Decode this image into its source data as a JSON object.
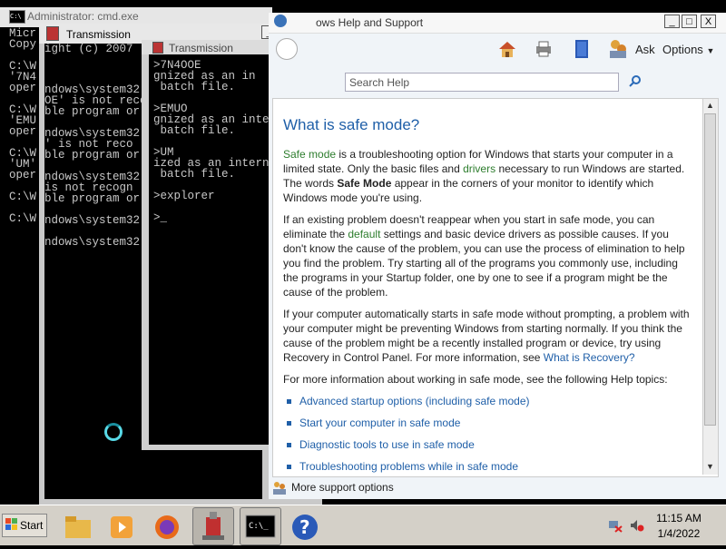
{
  "cmd_back": {
    "title": "Administrator: cmd.exe",
    "lines": [
      "Micr",
      "Copy",
      "",
      "C:\\W",
      "'7N4",
      "oper",
      "",
      "C:\\W",
      "'EMU",
      "oper",
      "",
      "C:\\W",
      "'UM'",
      "oper",
      "",
      "C:\\W",
      "",
      "C:\\W"
    ]
  },
  "cmd_window2": {
    "title": "Transmission",
    "header_fragment": "ight (c) 2007",
    "lines": [
      "",
      "",
      "",
      "ndows\\system32",
      "OE' is not reco",
      "ble program or",
      "",
      "ndows\\system32",
      "' is not reco",
      "ble program or",
      "",
      "ndows\\system32",
      "is not recogn",
      "ble program or",
      "",
      "ndows\\system32",
      "",
      "ndows\\system32"
    ]
  },
  "cmd_window3": {
    "title": "Transmission",
    "lines": [
      "",
      ">7N4OOE",
      "gnized as an in",
      " batch file.",
      "",
      ">EMUO",
      "gnized as an inte",
      " batch file.",
      "",
      ">UM",
      "ized as an intern",
      " batch file.",
      "",
      ">explorer",
      "",
      ">_"
    ]
  },
  "help": {
    "title": "ows Help and Support",
    "toolbar": {
      "ask_label": "Ask",
      "options_label": "Options"
    },
    "search_placeholder": "Search Help",
    "heading": "What is safe mode?",
    "p1": {
      "link1": "Safe mode",
      "t1": " is a troubleshooting option for Windows that starts your computer in a limited state. Only the basic files and ",
      "link2": "drivers",
      "t2": " necessary to run Windows are started. The words ",
      "bold": "Safe Mode",
      "t3": " appear in the corners of your monitor to identify which Windows mode you're using."
    },
    "p2": {
      "t1": "If an existing problem doesn't reappear when you start in safe mode, you can eliminate the ",
      "link": "default",
      "t2": " settings and basic device drivers as possible causes. If you don't know the cause of the problem, you can use the process of elimination to help you find the problem. Try starting all of the programs you commonly use, including the programs in your Startup folder, one by one to see if a program might be the cause of the problem."
    },
    "p3": {
      "t1": "If your computer automatically starts in safe mode without prompting, a problem with your computer might be preventing Windows from starting normally. If you think the cause of the problem might be a recently installed program or device, try using Recovery in Control Panel. For more information, see ",
      "link": "What is Recovery?"
    },
    "p4": "For more information about working in safe mode, see the following Help topics:",
    "links": [
      "Advanced startup options (including safe mode)",
      "Start your computer in safe mode",
      "Diagnostic tools to use in safe mode",
      "Troubleshooting problems while in safe mode"
    ],
    "more_support": "More support options"
  },
  "taskbar": {
    "start_label": "Start",
    "time": "11:15 AM",
    "date": "1/4/2022"
  },
  "window_buttons": {
    "min": "_",
    "max": "□",
    "close": "X"
  },
  "colors": {
    "help_link": "#1f5fa8",
    "taskbar": "#d4d0c8",
    "console_bg": "#000000"
  }
}
